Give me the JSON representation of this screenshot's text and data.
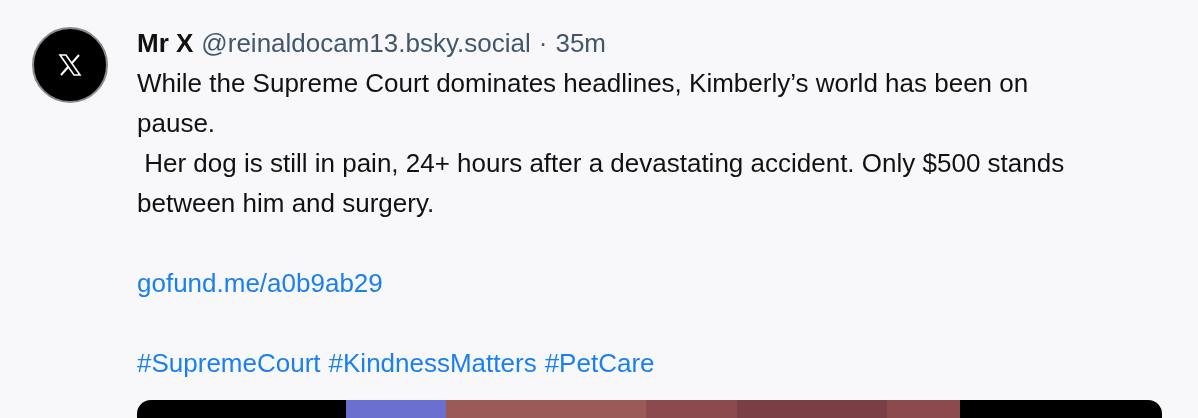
{
  "post": {
    "author": "Mr X",
    "handle": "@reinaldocam13.bsky.social",
    "separator": "·",
    "time": "35m",
    "paragraphs": [
      "While the Supreme Court dominates headlines, Kimberly’s world has been on pause.",
      " Her dog is still in pain, 24+ hours after a devastating accident. Only $500 stands between him and surgery."
    ],
    "link": "gofund.me/a0b9ab29",
    "hashtags": [
      "#SupremeCourt",
      "#KindnessMatters",
      "#PetCare"
    ],
    "media": {
      "kind": "picture"
    }
  }
}
